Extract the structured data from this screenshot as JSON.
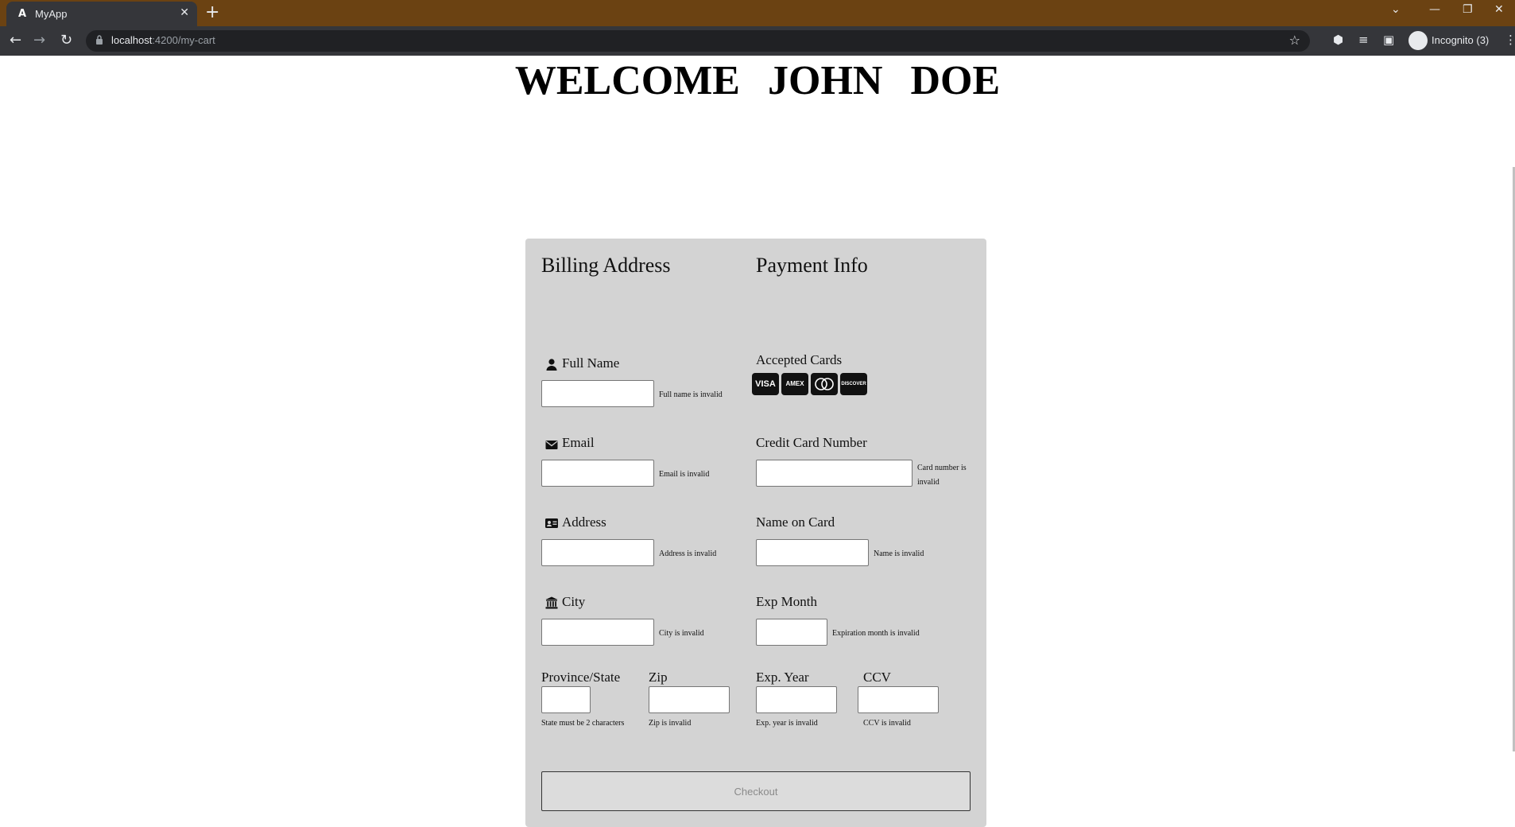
{
  "browser": {
    "tab_title": "MyApp",
    "favicon_letter": "A",
    "url_host": "localhost",
    "url_path": ":4200/my-cart",
    "profile_label": "Incognito (3)"
  },
  "page": {
    "welcome": "WELCOME JOHN DOE"
  },
  "billing": {
    "heading": "Billing Address",
    "full_name": {
      "label": "Full Name",
      "error": "Full name is invalid",
      "value": ""
    },
    "email": {
      "label": "Email",
      "error": "Email is invalid",
      "value": ""
    },
    "address": {
      "label": "Address",
      "error": "Address is invalid",
      "value": ""
    },
    "city": {
      "label": "City",
      "error": "City is invalid",
      "value": ""
    },
    "state": {
      "label": "Province/State",
      "error": "State must be 2 characters",
      "value": ""
    },
    "zip": {
      "label": "Zip",
      "error": "Zip is invalid",
      "value": ""
    }
  },
  "payment": {
    "heading": "Payment Info",
    "accepted_cards": {
      "label": "Accepted Cards",
      "cards": [
        "VISA",
        "AMEX",
        "MC",
        "DISCOVER"
      ]
    },
    "card_number": {
      "label": "Credit Card Number",
      "error": "Card number is invalid",
      "value": ""
    },
    "name_on_card": {
      "label": "Name on Card",
      "error": "Name is invalid",
      "value": ""
    },
    "exp_month": {
      "label": "Exp Month",
      "error": "Expiration month is invalid",
      "value": ""
    },
    "exp_year": {
      "label": "Exp. Year",
      "error": "Exp. year is invalid",
      "value": ""
    },
    "ccv": {
      "label": "CCV",
      "error": "CCV is invalid",
      "value": ""
    }
  },
  "checkout_label": "Checkout",
  "colors": {
    "tabbar": "#6b4212",
    "panel": "#d3d3d3"
  }
}
